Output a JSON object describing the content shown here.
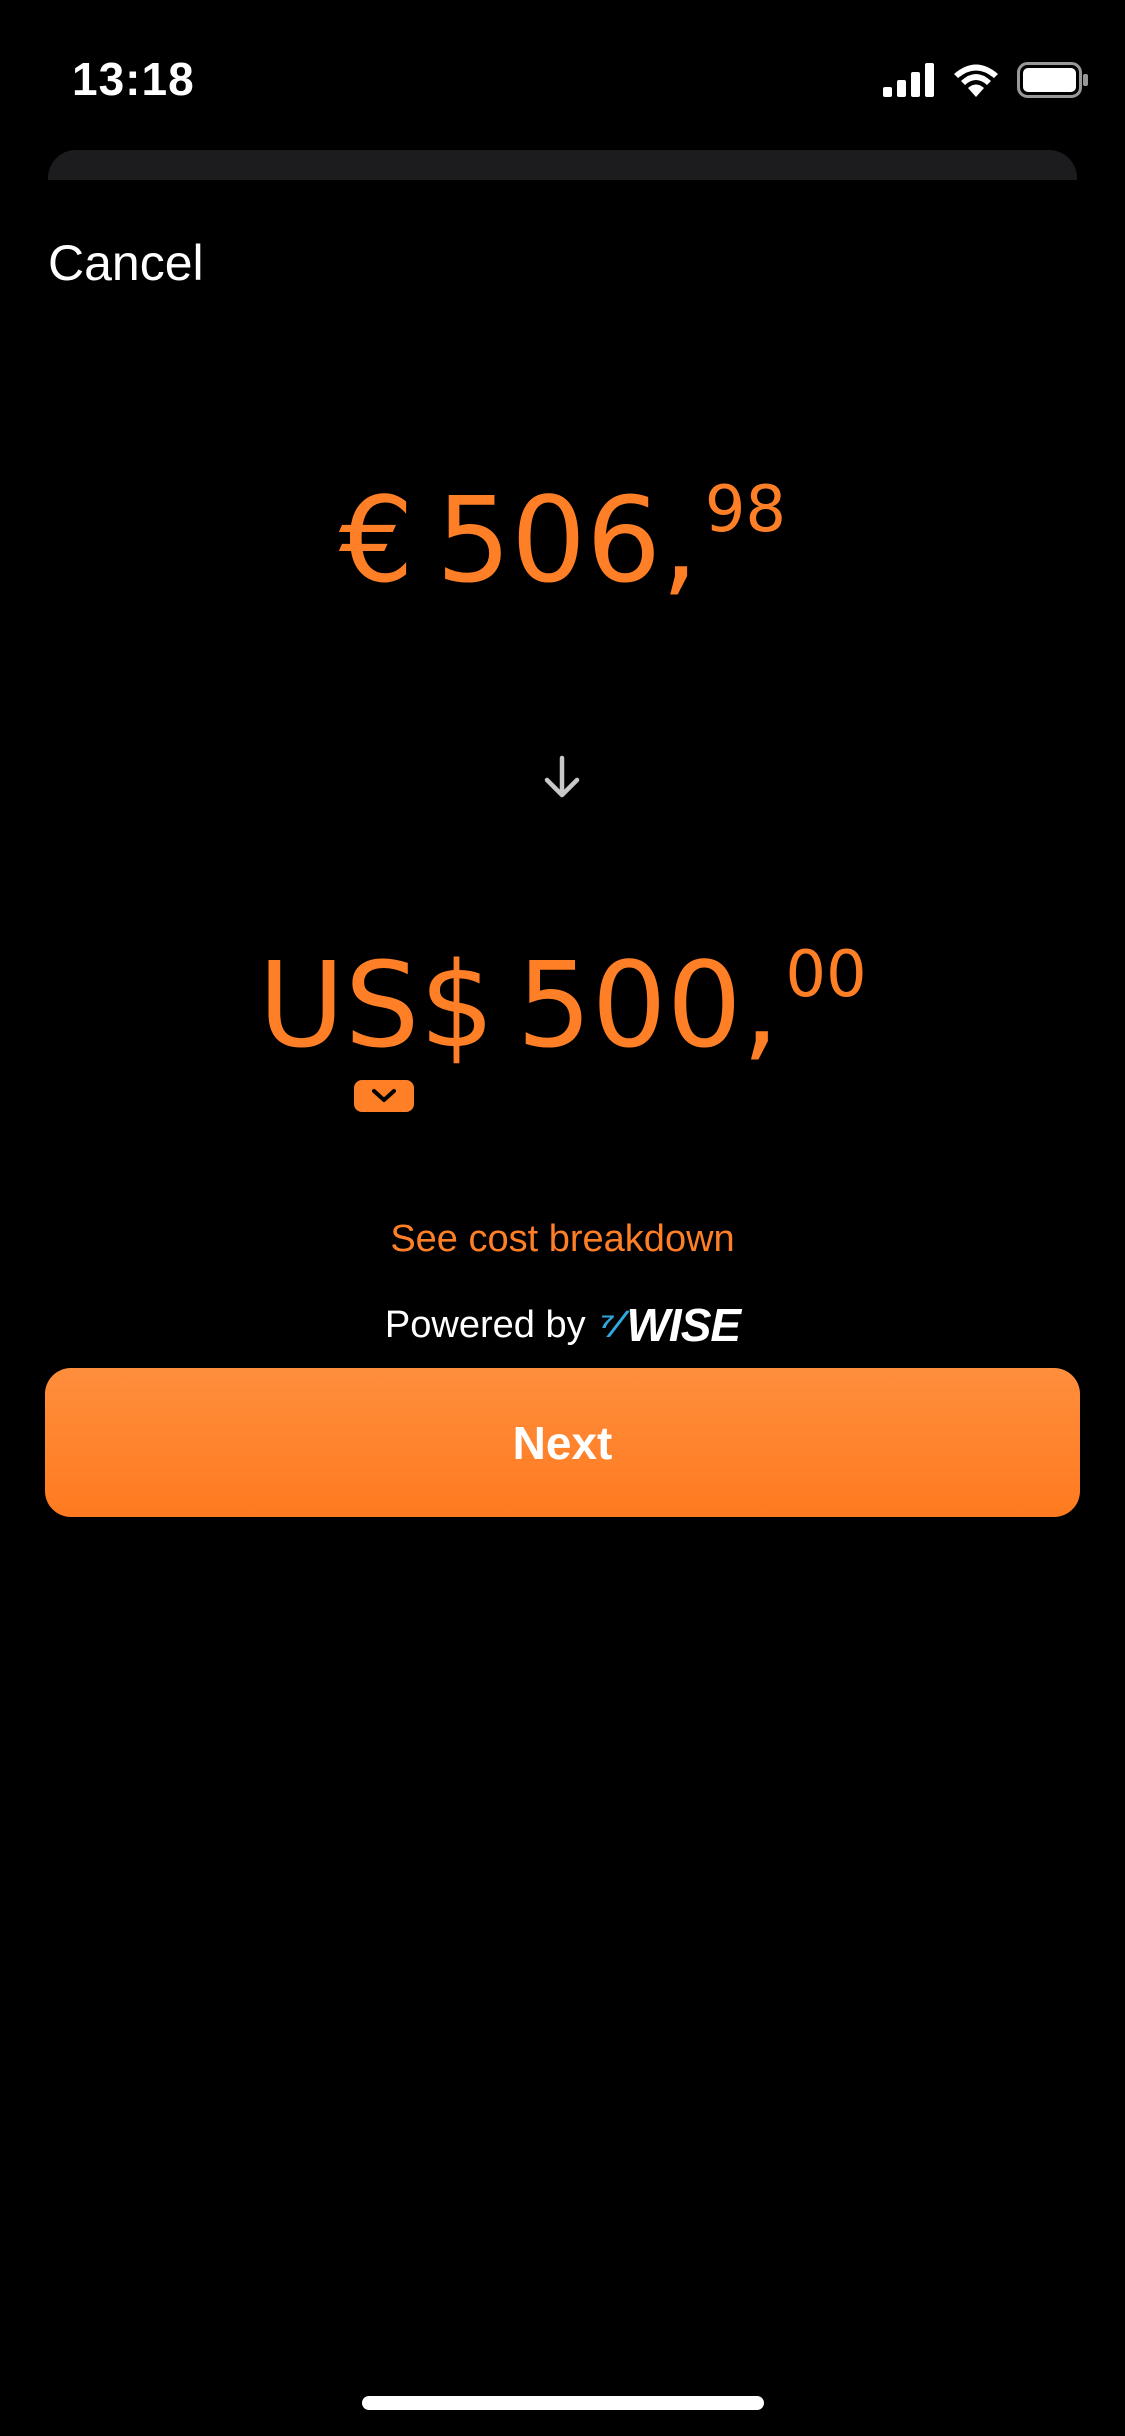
{
  "status_bar": {
    "time": "13:18",
    "icons": [
      "cellular-signal-icon",
      "wifi-icon",
      "battery-icon"
    ]
  },
  "header": {
    "cancel_label": "Cancel"
  },
  "send_amount": {
    "symbol": "€",
    "major": "506,",
    "minor": "98"
  },
  "receive_amount": {
    "symbol": "US$",
    "major": "500,",
    "minor": "00"
  },
  "cost_breakdown_label": "See cost breakdown",
  "powered_by": {
    "label": "Powered by",
    "brand": "WISE"
  },
  "next_label": "Next",
  "colors": {
    "accent": "#ff7f27",
    "background": "#000000",
    "wise_blue": "#2fa8e0"
  }
}
